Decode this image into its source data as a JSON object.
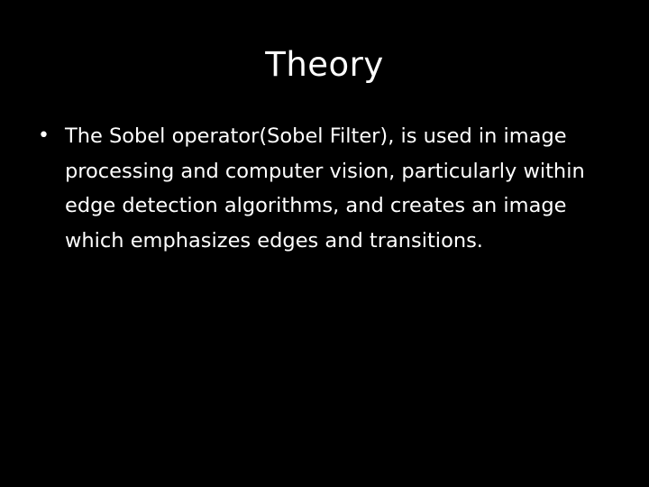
{
  "slide": {
    "title": "Theory",
    "bullets": [
      {
        "marker": "•",
        "text": "The Sobel operator(Sobel Filter), is used in image processing and computer vision, particularly within edge detection algorithms, and creates an image which emphasizes edges and transitions."
      }
    ]
  },
  "colors": {
    "background": "#000000",
    "text": "#ffffff"
  }
}
